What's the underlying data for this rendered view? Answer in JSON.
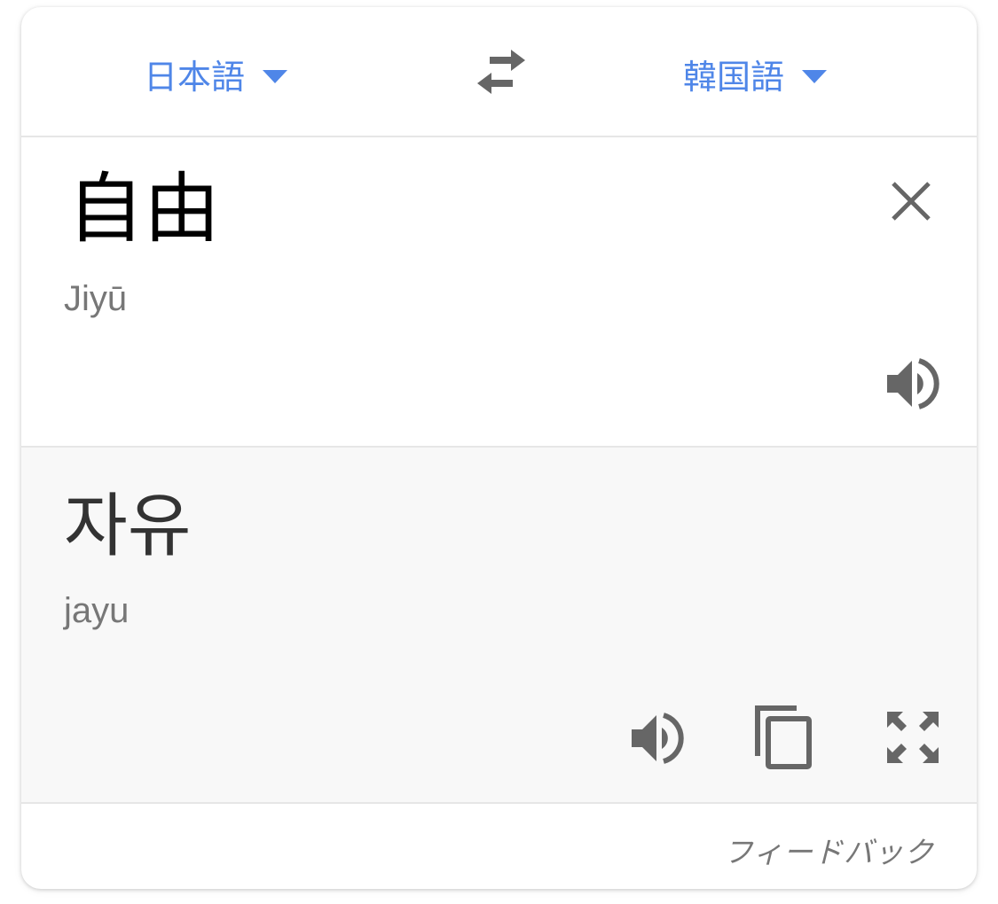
{
  "language_bar": {
    "source_language": "日本語",
    "target_language": "韓国語",
    "accent_color": "#4f86e8"
  },
  "source": {
    "text": "自由",
    "transliteration": "Jiyū"
  },
  "result": {
    "text": "자유",
    "transliteration": "jayu"
  },
  "footer": {
    "feedback_label": "フィードバック"
  },
  "icons": {
    "swap": "swap-languages-icon",
    "clear": "close-icon",
    "speak": "speaker-icon",
    "copy": "copy-icon",
    "fullscreen": "fullscreen-icon"
  }
}
